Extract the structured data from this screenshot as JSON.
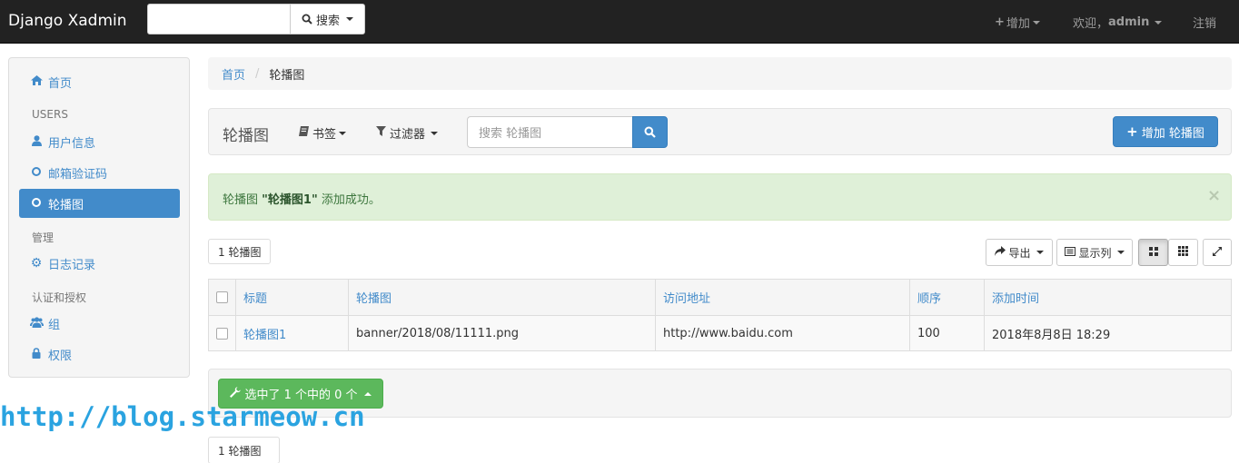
{
  "navbar": {
    "brand": "Django Xadmin",
    "search_button": "搜索",
    "add_label": "增加",
    "welcome_prefix": "欢迎，",
    "username": "admin",
    "logout": "注销"
  },
  "sidebar": {
    "home": "首页",
    "group_users": "USERS",
    "user_info": "用户信息",
    "email_code": "邮箱验证码",
    "banner": "轮播图",
    "group_manage": "管理",
    "log": "日志记录",
    "group_auth": "认证和授权",
    "group": "组",
    "permission": "权限"
  },
  "breadcrumb": {
    "home": "首页",
    "separator": "/",
    "current": "轮播图"
  },
  "toolbar": {
    "title": "轮播图",
    "bookmarks": "书签",
    "filters": "过滤器",
    "search_placeholder": "搜索 轮播图",
    "add_button": "增加 轮播图"
  },
  "alert": {
    "model": "轮播图",
    "object": "\"轮播图1\"",
    "suffix": "添加成功。",
    "close": "×"
  },
  "list": {
    "count_top": "1 轮播图",
    "count_bottom": "1 轮播图",
    "export": "导出",
    "columns_btn": "显示列",
    "headers": [
      "标题",
      "轮播图",
      "访问地址",
      "顺序",
      "添加时间"
    ],
    "rows": [
      [
        "轮播图1",
        "banner/2018/08/11111.png",
        "http://www.baidu.com",
        "100",
        "2018年8月8日 18:29"
      ]
    ]
  },
  "actions": {
    "selected_label": "选中了 1 个中的 0 个"
  },
  "watermark": "http://blog.starmeow.cn",
  "colors": {
    "primary": "#428bca",
    "success": "#5cb85c",
    "navbar": "#222222",
    "alert_bg": "#dff0d8"
  }
}
